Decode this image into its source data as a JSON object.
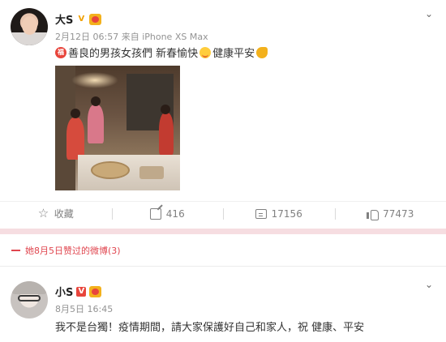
{
  "post1": {
    "author": "大S",
    "time": "2月12日 06:57",
    "source": "来自 iPhone XS Max",
    "text_part1": "善良的男孩女孩們 新春愉快",
    "text_part2": "健康平安",
    "emoji_icon_1": "red-envelope-emoji-icon",
    "actions": {
      "collect_label": "收藏",
      "repost_count": "416",
      "comment_count": "17156",
      "like_count": "77473"
    }
  },
  "liked_banner": {
    "text": "她8月5日赞过的微博(3)"
  },
  "post2": {
    "author": "小S",
    "time": "8月5日 16:45",
    "text": "我不是台獨！疫情期間，請大家保護好自己和家人，祝 健康、平安"
  },
  "colors": {
    "accent_red": "#e0464f",
    "verified_gold": "#f0a000",
    "verified_red": "#e8453c",
    "meta_gray": "#939393"
  }
}
